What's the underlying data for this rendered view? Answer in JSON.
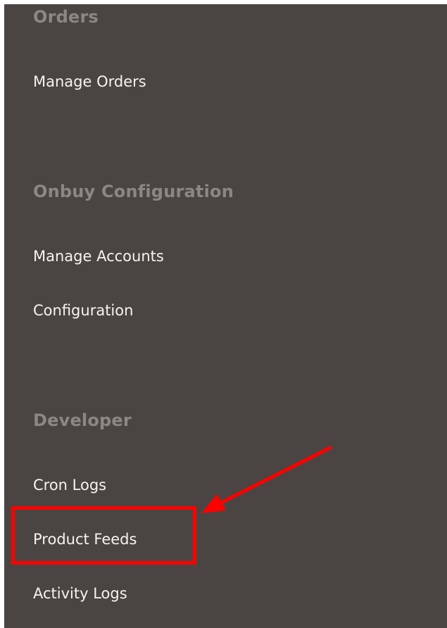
{
  "sections": [
    {
      "title": "Orders",
      "items": [
        "Manage Orders"
      ]
    },
    {
      "title": "Onbuy Configuration",
      "items": [
        "Manage Accounts",
        "Configuration"
      ]
    },
    {
      "title": "Developer",
      "items": [
        "Cron Logs",
        "Product Feeds",
        "Activity Logs"
      ]
    }
  ],
  "highlighted_item": "Product Feeds",
  "colors": {
    "panel_background": "#4a4542",
    "section_title": "#8c8783",
    "menu_link": "#f7f3eb",
    "annotation": "#ff0000"
  }
}
